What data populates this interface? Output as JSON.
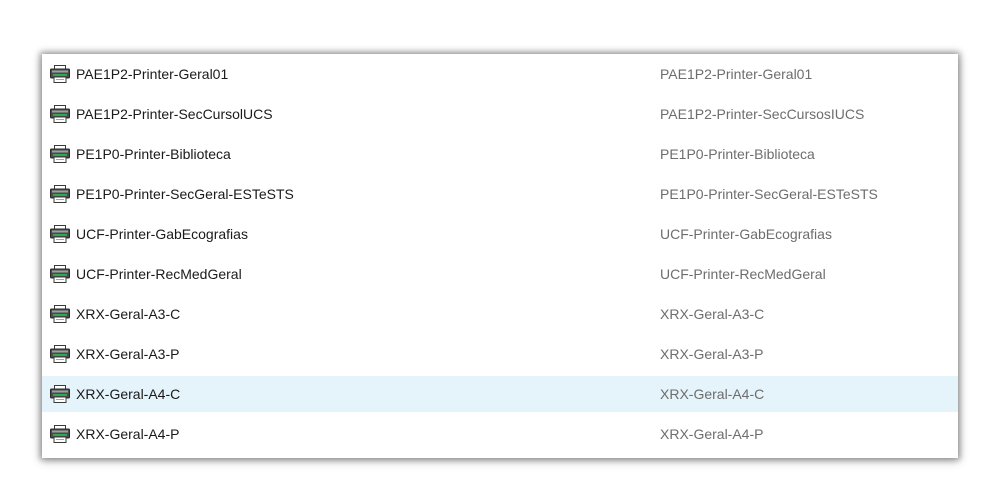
{
  "accent_color": "#e5f3fb",
  "icon": "printer-icon",
  "printers": [
    {
      "name": "PAE1P2-Printer-Geral01",
      "share": "PAE1P2-Printer-Geral01",
      "selected": false
    },
    {
      "name": "PAE1P2-Printer-SecCursolUCS",
      "share": "PAE1P2-Printer-SecCursosIUCS",
      "selected": false
    },
    {
      "name": "PE1P0-Printer-Biblioteca",
      "share": "PE1P0-Printer-Biblioteca",
      "selected": false
    },
    {
      "name": "PE1P0-Printer-SecGeral-ESTeSTS",
      "share": "PE1P0-Printer-SecGeral-ESTeSTS",
      "selected": false
    },
    {
      "name": "UCF-Printer-GabEcografias",
      "share": "UCF-Printer-GabEcografias",
      "selected": false
    },
    {
      "name": "UCF-Printer-RecMedGeral",
      "share": "UCF-Printer-RecMedGeral",
      "selected": false
    },
    {
      "name": "XRX-Geral-A3-C",
      "share": "XRX-Geral-A3-C",
      "selected": false
    },
    {
      "name": "XRX-Geral-A3-P",
      "share": "XRX-Geral-A3-P",
      "selected": false
    },
    {
      "name": "XRX-Geral-A4-C",
      "share": "XRX-Geral-A4-C",
      "selected": true
    },
    {
      "name": "XRX-Geral-A4-P",
      "share": "XRX-Geral-A4-P",
      "selected": false
    }
  ]
}
